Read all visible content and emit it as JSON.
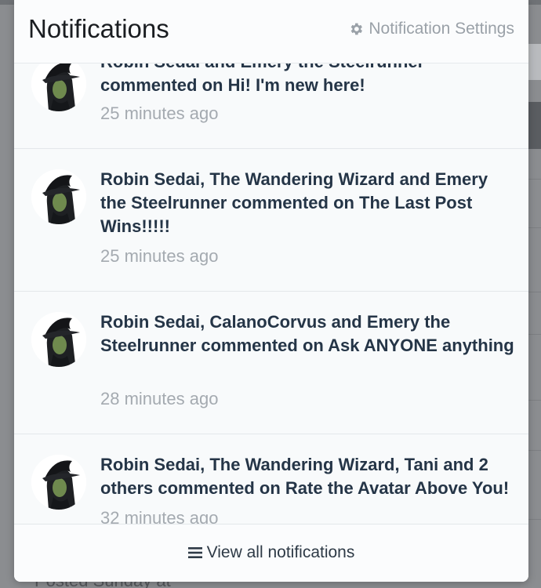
{
  "header": {
    "title": "Notifications",
    "settings_label": "Notification Settings",
    "settings_icon": "gear-icon"
  },
  "notifications": [
    {
      "text_line1": "Robin Sedai and Emery the Steelrunner",
      "text_rest": "commented on Hi! I'm new here!",
      "time": "25 minutes ago"
    },
    {
      "text": "Robin Sedai, The Wandering Wizard and Emery the Steelrunner commented on The Last Post Wins!!!!!",
      "time": "25 minutes ago"
    },
    {
      "text": "Robin Sedai, CalanoCorvus and Emery the Steelrunner commented on Ask ANYONE anything",
      "time": "28 minutes ago"
    },
    {
      "text": "Robin Sedai, The Wandering Wizard, Tani and 2 others commented on Rate the Avatar Above You!",
      "time": "32 minutes ago"
    }
  ],
  "footer": {
    "view_all_label": "View all notifications",
    "view_all_icon": "list-icon"
  },
  "background": {
    "partial_text": "Posted Sunday at"
  },
  "colors": {
    "panel_bg": "#f8fafb",
    "title_text": "#1a1d21",
    "notification_text": "#253547",
    "time_text": "#a4aab0",
    "settings_text": "#9aa1a8",
    "overlay_bg": "#8b8d90"
  }
}
